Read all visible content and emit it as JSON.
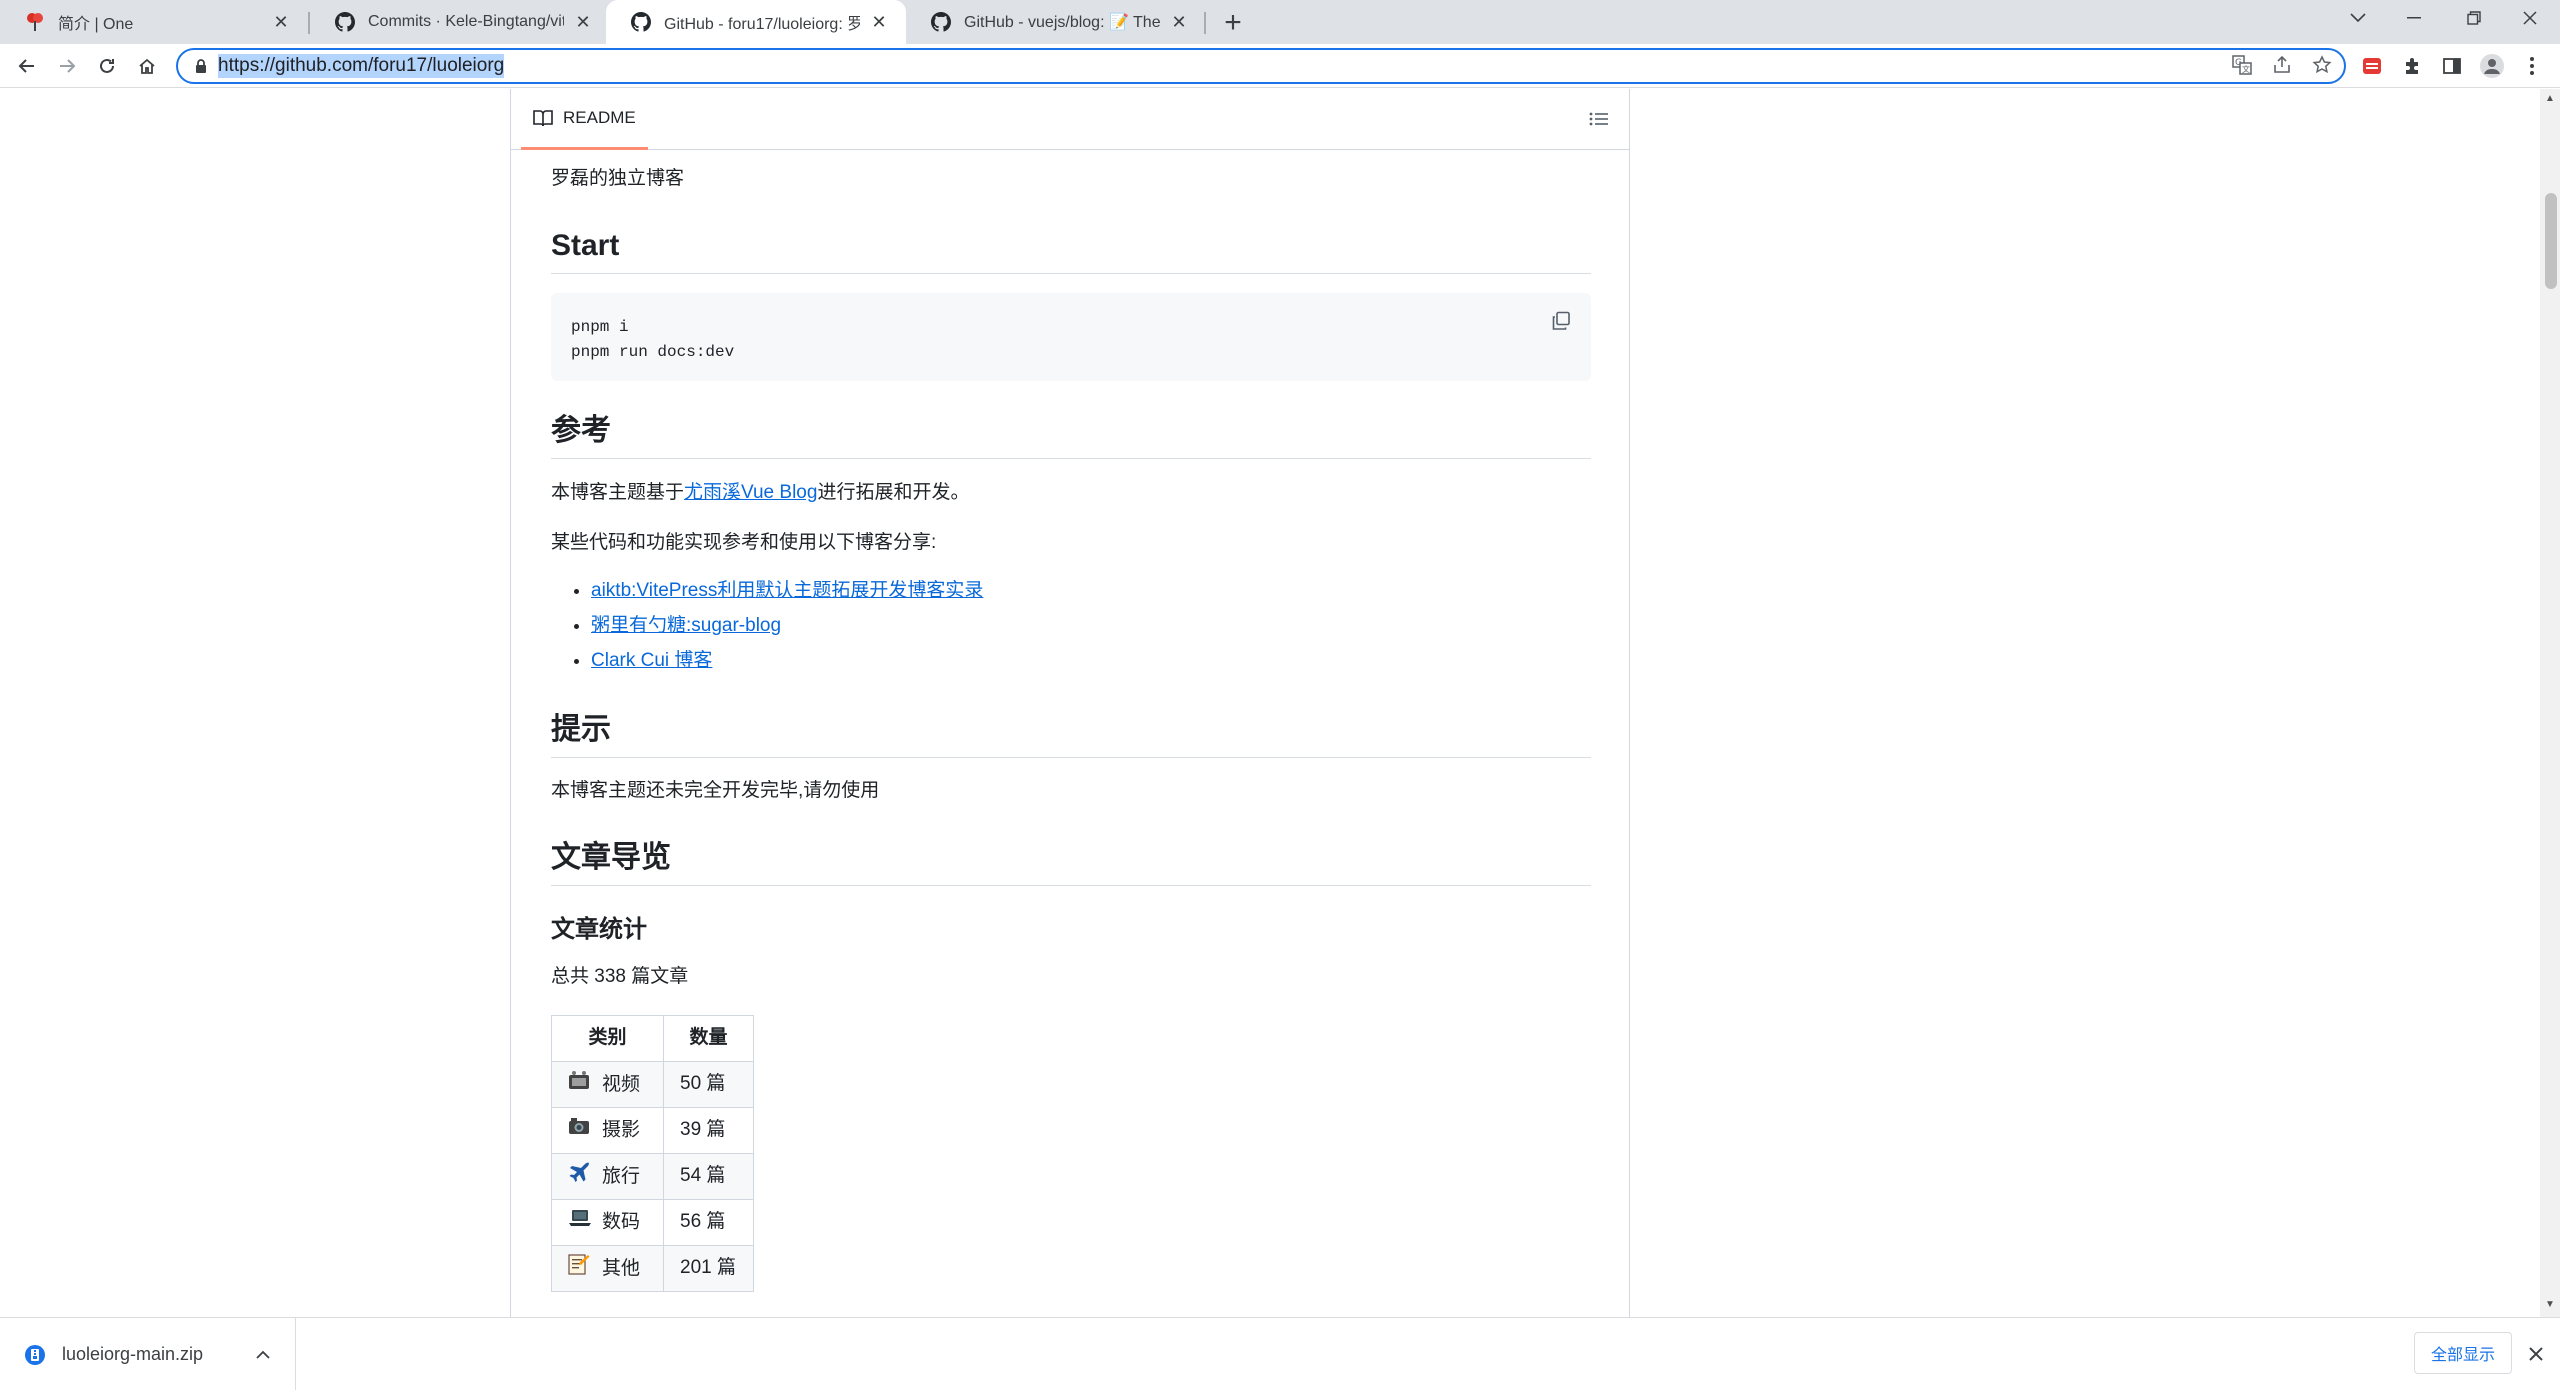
{
  "browser": {
    "tabs": [
      {
        "title": "简介 | One",
        "favicon": "red-flower-icon",
        "active": false
      },
      {
        "title": "Commits · Kele-Bingtang/vitepress",
        "favicon": "github-icon",
        "active": false
      },
      {
        "title": "GitHub - foru17/luoleiorg: 罗磊",
        "favicon": "github-icon",
        "active": true
      },
      {
        "title": "GitHub - vuejs/blog: 📝 The o",
        "favicon": "github-icon",
        "active": false
      }
    ],
    "url": "https://github.com/foru17/luoleiorg",
    "colors": {
      "accent": "#1a73e8",
      "tabstrip": "#dee1e6"
    }
  },
  "readme": {
    "tab_label": "README",
    "intro": "罗磊的独立博客",
    "start_heading": "Start",
    "code_lines": [
      "pnpm i",
      "pnpm run docs:dev"
    ],
    "ref_heading": "参考",
    "ref_text_before": "本博客主题基于",
    "ref_link": "尤雨溪Vue Blog",
    "ref_text_after": "进行拓展和开发。",
    "ref_text2": "某些代码和功能实现参考和使用以下博客分享:",
    "ref_links": [
      "aiktb:VitePress利用默认主题拓展开发博客实录",
      "粥里有勺糖:sugar-blog",
      "Clark Cui 博客"
    ],
    "tip_heading": "提示",
    "tip_text": "本博客主题还未完全开发完毕,请勿使用",
    "nav_heading": "文章导览",
    "stats_heading": "文章统计",
    "stats_total": "总共 338 篇文章",
    "table": {
      "headers": [
        "类别",
        "数量"
      ],
      "rows": [
        {
          "icon": "video-camera-icon",
          "category": "视频",
          "count": "50 篇"
        },
        {
          "icon": "photo-camera-icon",
          "category": "摄影",
          "count": "39 篇"
        },
        {
          "icon": "airplane-icon",
          "category": "旅行",
          "count": "54 篇"
        },
        {
          "icon": "laptop-icon",
          "category": "数码",
          "count": "56 篇"
        },
        {
          "icon": "memo-icon",
          "category": "其他",
          "count": "201 篇"
        }
      ]
    },
    "colors": {
      "link": "#0969da",
      "tab_underline": "#fd8c73",
      "border": "#d0d7de"
    }
  },
  "downloads": {
    "file_name": "luoleiorg-main.zip",
    "show_all": "全部显示"
  }
}
